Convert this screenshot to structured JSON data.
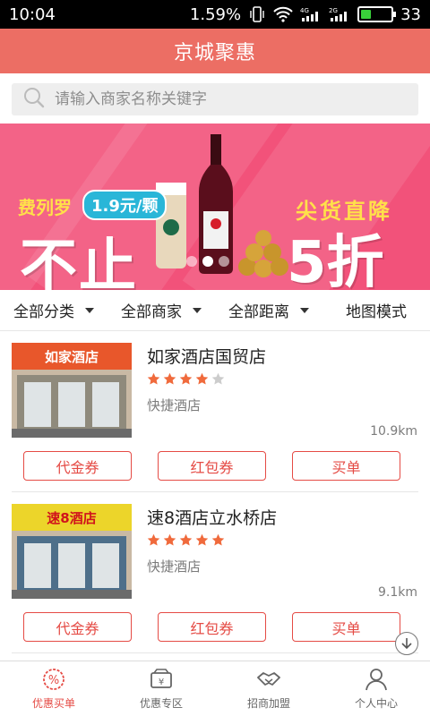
{
  "status": {
    "time": "10:04",
    "speed": "1.59%",
    "network1": "4G",
    "network2": "2G",
    "battery": "33",
    "battery_level": 0.33
  },
  "header": {
    "title": "京城聚惠"
  },
  "search": {
    "placeholder": "请输入商家名称关键字"
  },
  "banner": {
    "brand": "费列罗",
    "price": "1.9元/颗",
    "headline": "不止",
    "subline": "尖货直降",
    "headline2": "5折",
    "slides": 3,
    "active_slide": 1
  },
  "filters": [
    {
      "label": "全部分类",
      "has_caret": true
    },
    {
      "label": "全部商家",
      "has_caret": true
    },
    {
      "label": "全部距离",
      "has_caret": true
    },
    {
      "label": "地图模式",
      "has_caret": false
    }
  ],
  "merchants": [
    {
      "name": "如家酒店国贸店",
      "rating": 4,
      "max_rating": 5,
      "category": "快捷酒店",
      "distance": "10.9km",
      "sign_text": "如家酒店",
      "buttons": [
        "代金券",
        "红包券",
        "买单"
      ]
    },
    {
      "name": "速8酒店立水桥店",
      "rating": 5,
      "max_rating": 5,
      "category": "快捷酒店",
      "distance": "9.1km",
      "sign_text": "速8酒店",
      "buttons": [
        "代金券",
        "红包券",
        "买单"
      ]
    }
  ],
  "tabs": [
    {
      "label": "优惠买单",
      "icon": "discount-icon",
      "active": true
    },
    {
      "label": "优惠专区",
      "icon": "ticket-icon",
      "active": false
    },
    {
      "label": "招商加盟",
      "icon": "handshake-icon",
      "active": false
    },
    {
      "label": "个人中心",
      "icon": "person-icon",
      "active": false
    }
  ],
  "colors": {
    "primary": "#ec6e64",
    "accent": "#e54b45",
    "star": "#f06a3c",
    "star_empty": "#cccccc"
  }
}
